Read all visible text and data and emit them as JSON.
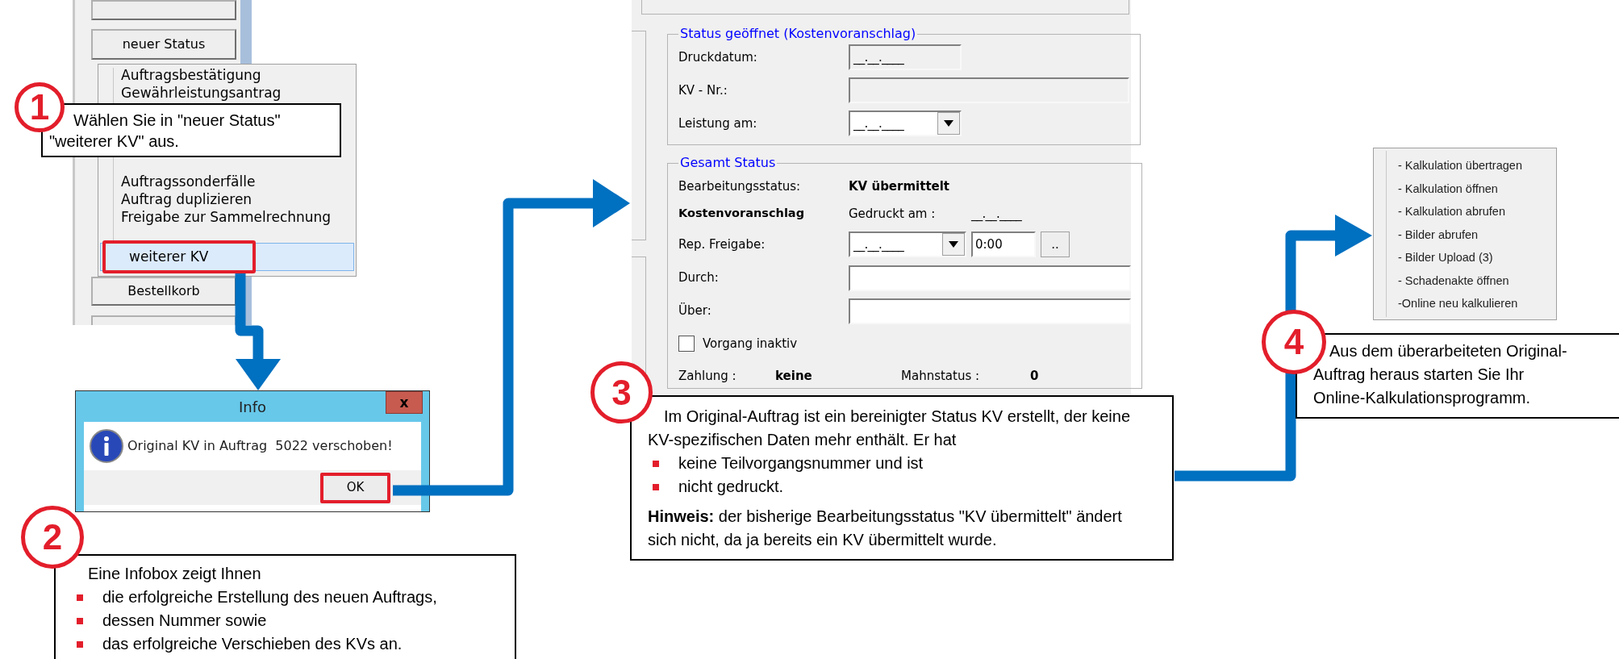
{
  "order_panel": {
    "buttons": [
      {
        "label": "neuer Status"
      },
      {
        "label": "Bestellkorb"
      }
    ],
    "menu": {
      "items": [
        {
          "label": "Auftragsbestätigung",
          "selected": false
        },
        {
          "label": "Gewährleistungsantrag",
          "selected": false
        },
        {
          "label": "Auftragssonderfälle",
          "selected": false
        },
        {
          "label": "Auftrag duplizieren",
          "selected": false
        },
        {
          "label": "Freigabe zur Sammelrechnung",
          "selected": false
        },
        {
          "label": "weiterer KV",
          "selected": true
        }
      ]
    }
  },
  "dialog": {
    "title": "Info",
    "close": "x",
    "message": "Original KV in Auftrag  5022 verschoben!",
    "button": "OK"
  },
  "form": {
    "group_1": {
      "title": "Status geöffnet (Kostenvoranschlag)",
      "rows": [
        {
          "kind": "date",
          "label": "Druckdatum:",
          "value": "__.__.____"
        },
        {
          "kind": "text",
          "label": "KV - Nr.:"
        },
        {
          "kind": "dropdown",
          "label": "Leistung am:",
          "value": "__.__.____"
        }
      ]
    },
    "group_2": {
      "title": "Gesamt Status",
      "status_label": "Bearbeitungsstatus:",
      "status_value": "KV übermittelt",
      "kv_label": "Kostenvoranschlag",
      "printed_label": "Gedruckt am :",
      "printed_value": "__.__.____",
      "release": {
        "label": "Rep. Freigabe:",
        "date": "__.__.____",
        "time": "0:00",
        "button": ".."
      },
      "fields": [
        {
          "label": "Durch:"
        },
        {
          "label": "Über:"
        }
      ],
      "inactive": {
        "label": "Vorgang inaktiv",
        "checked": false
      },
      "payment_label": "Zahlung :",
      "payment_value": "keine",
      "dunning_label": "Mahnstatus :",
      "dunning_value": "0"
    }
  },
  "calc_menu": {
    "items": [
      "- Kalkulation übertragen",
      "- Kalkulation öffnen",
      "- Kalkulation abrufen",
      "- Bilder abrufen",
      "- Bilder Upload (3)",
      "- Schadenakte öffnen",
      "-Online neu kalkulieren"
    ]
  },
  "callouts": [
    {
      "number": "1",
      "lines": [
        "Wählen Sie in \"neuer Status\"",
        "\"weiterer KV\" aus."
      ]
    },
    {
      "number": "2",
      "intro": "Eine Infobox zeigt Ihnen",
      "bullets": [
        "die erfolgreiche Erstellung des neuen Auftrags,",
        "dessen Nummer sowie",
        "das erfolgreiche Verschieben des KVs an."
      ]
    },
    {
      "number": "3",
      "intro": "Im Original-Auftrag ist ein bereinigter Status KV erstellt, der keine KV-spezifischen Daten mehr enthält. Er hat",
      "bullets": [
        "keine Teilvorgangsnummer und ist",
        "nicht gedruckt."
      ],
      "note": "**Hinweis:** der bisherige Bearbeitungsstatus \"KV übermittelt\" ändert sich nicht, da ja bereits ein KV übermittelt wurde."
    },
    {
      "number": "4",
      "lines": [
        "Aus dem überarbeiteten Original-",
        "Auftrag heraus starten Sie Ihr",
        "Online-Kalkulationsprogramm."
      ]
    }
  ]
}
